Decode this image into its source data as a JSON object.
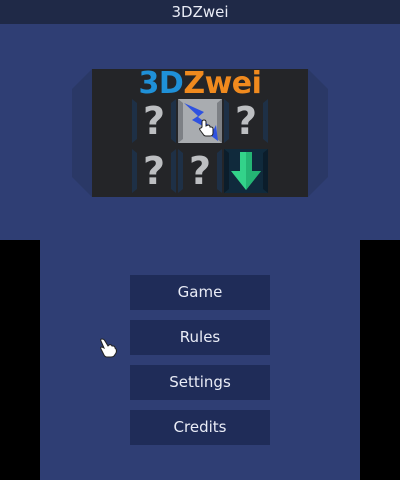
{
  "window": {
    "title": "3DZwei"
  },
  "logo": {
    "part1": "3D",
    "part2": "Zwei"
  },
  "tiles": [
    {
      "state": "hidden",
      "symbol": "?"
    },
    {
      "state": "revealed",
      "picture": "lightning-bolt",
      "color": "#2f52e0"
    },
    {
      "state": "hidden",
      "symbol": "?"
    },
    {
      "state": "hidden",
      "symbol": "?"
    },
    {
      "state": "hidden",
      "symbol": "?"
    },
    {
      "state": "revealed",
      "picture": "down-arrow",
      "color": "#33d38a"
    }
  ],
  "menu": {
    "game_label": "Game",
    "rules_label": "Rules",
    "settings_label": "Settings",
    "credits_label": "Credits"
  },
  "colors": {
    "background": "#2f3e74",
    "button": "#1f2c58",
    "banner": "#242528",
    "logo_blue": "#1f90d8",
    "logo_orange": "#f08a1e"
  }
}
